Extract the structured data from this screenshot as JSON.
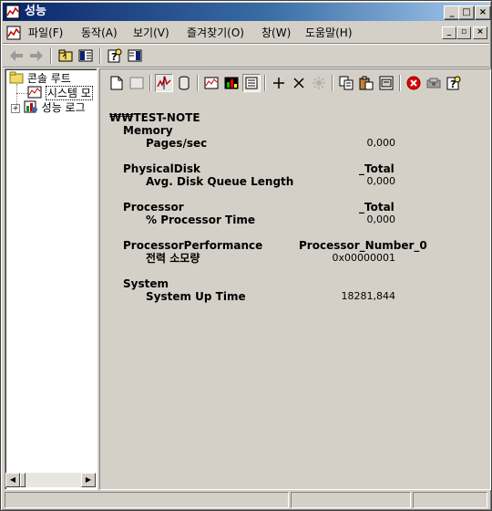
{
  "window": {
    "title": "성능",
    "controls": {
      "minimize": "_",
      "maximize": "□",
      "close": "×"
    }
  },
  "menubar": {
    "items": [
      "파일(F)",
      "동작(A)",
      "보기(V)",
      "즐겨찾기(O)",
      "창(W)",
      "도움말(H)"
    ],
    "mdi": {
      "minimize": "_",
      "restore": "▫",
      "close": "×"
    }
  },
  "toolbar": {
    "icons": [
      "back-arrow-icon",
      "forward-arrow-icon",
      "up-folder-icon",
      "show-hide-tree-icon",
      "help-icon",
      "properties-pane-icon"
    ]
  },
  "tree": {
    "items": [
      {
        "label": "콘솔 루트",
        "expander": ""
      },
      {
        "label": "시스템 모",
        "expander": ""
      },
      {
        "label": "성능 로그",
        "expander": "+"
      }
    ]
  },
  "monitor_toolbar": {
    "icons": [
      "new-counter-set-icon",
      "clear-display-icon",
      "view-current-activity-icon",
      "view-log-data-icon",
      "view-graph-icon",
      "view-histogram-icon",
      "view-report-icon",
      "add-icon",
      "delete-icon",
      "highlight-icon",
      "copy-properties-icon",
      "paste-counter-list-icon",
      "properties-icon",
      "freeze-display-icon",
      "update-data-icon",
      "help-icon"
    ]
  },
  "report": {
    "computer": "₩₩TEST-NOTE",
    "objects": [
      {
        "name": "Memory",
        "instance": "",
        "counters": [
          {
            "name": "Pages/sec",
            "value": "0,000"
          }
        ]
      },
      {
        "name": "PhysicalDisk",
        "instance": "_Total",
        "counters": [
          {
            "name": "Avg. Disk Queue Length",
            "value": "0,000"
          }
        ]
      },
      {
        "name": "Processor",
        "instance": "_Total",
        "counters": [
          {
            "name": "% Processor Time",
            "value": "0,000"
          }
        ]
      },
      {
        "name": "ProcessorPerformance",
        "instance": "Processor_Number_0",
        "counters": [
          {
            "name": "전력 소모량",
            "value": "0x00000001"
          }
        ]
      },
      {
        "name": "System",
        "instance": "",
        "counters": [
          {
            "name": "System Up Time",
            "value": "18281,844"
          }
        ]
      }
    ]
  },
  "colors": {
    "title_gradient_start": "#0a246a",
    "title_gradient_end": "#a6caf0",
    "face": "#d4d0c8"
  }
}
